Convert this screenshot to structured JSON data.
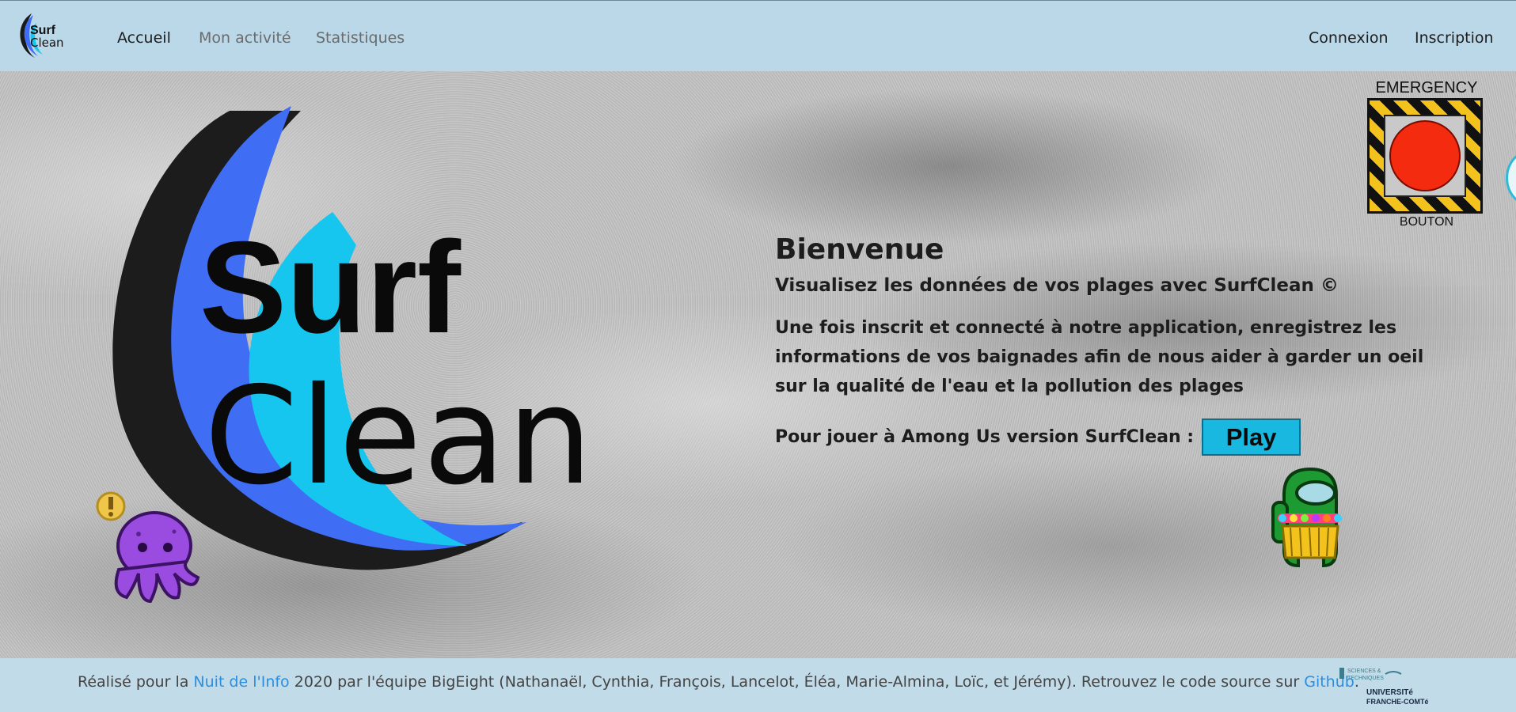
{
  "navbar": {
    "brand_top": "Surf",
    "brand_bottom": "Clean",
    "links": [
      {
        "label": "Accueil"
      },
      {
        "label": "Mon activité"
      },
      {
        "label": "Statistiques"
      }
    ],
    "right_links": [
      {
        "label": "Connexion"
      },
      {
        "label": "Inscription"
      }
    ]
  },
  "hero": {
    "logo_top": "Surf",
    "logo_bottom": "Clean",
    "title": "Bienvenue",
    "tagline": "Visualisez les données de vos plages avec SurfClean ©",
    "description": "Une fois inscrit et connecté à notre application, enregistrez les informations de vos baignades afin de nous aider à garder un oeil sur la qualité de l'eau et la pollution des plages",
    "play_prompt": "Pour jouer à Among Us version SurfClean :",
    "play_label": "Play",
    "emergency_top": "EMERGENCY",
    "emergency_bottom": "BOUTON"
  },
  "footer": {
    "prefix": "Réalisé pour la ",
    "event_link": "Nuit de l'Info",
    "middle": " 2020 par l'équipe BigEight (Nathanaël, Cynthia, François, Lancelot, Éléa, Marie-Almina, Loïc, et Jérémy). Retrouvez le code source sur ",
    "github_link": "Github",
    "suffix": ".",
    "logo_line1": "SCIENCES &",
    "logo_line2": "TECHNIQUES",
    "logo_line3": "UNIVERSITé",
    "logo_line4": "FRANCHE-COMTé"
  },
  "colors": {
    "navbar_bg": "#bbd8e9",
    "footer_bg": "#c2dbe9",
    "link_blue": "#2b8ee0",
    "play_btn": "#18b8e0",
    "logo_blue": "#3f6df3",
    "logo_cyan": "#16c6ee"
  },
  "icons": [
    "surfclean-logo-icon",
    "emergency-button-icon",
    "octopus-icon",
    "crewmate-icon",
    "universite-logo-icon"
  ]
}
